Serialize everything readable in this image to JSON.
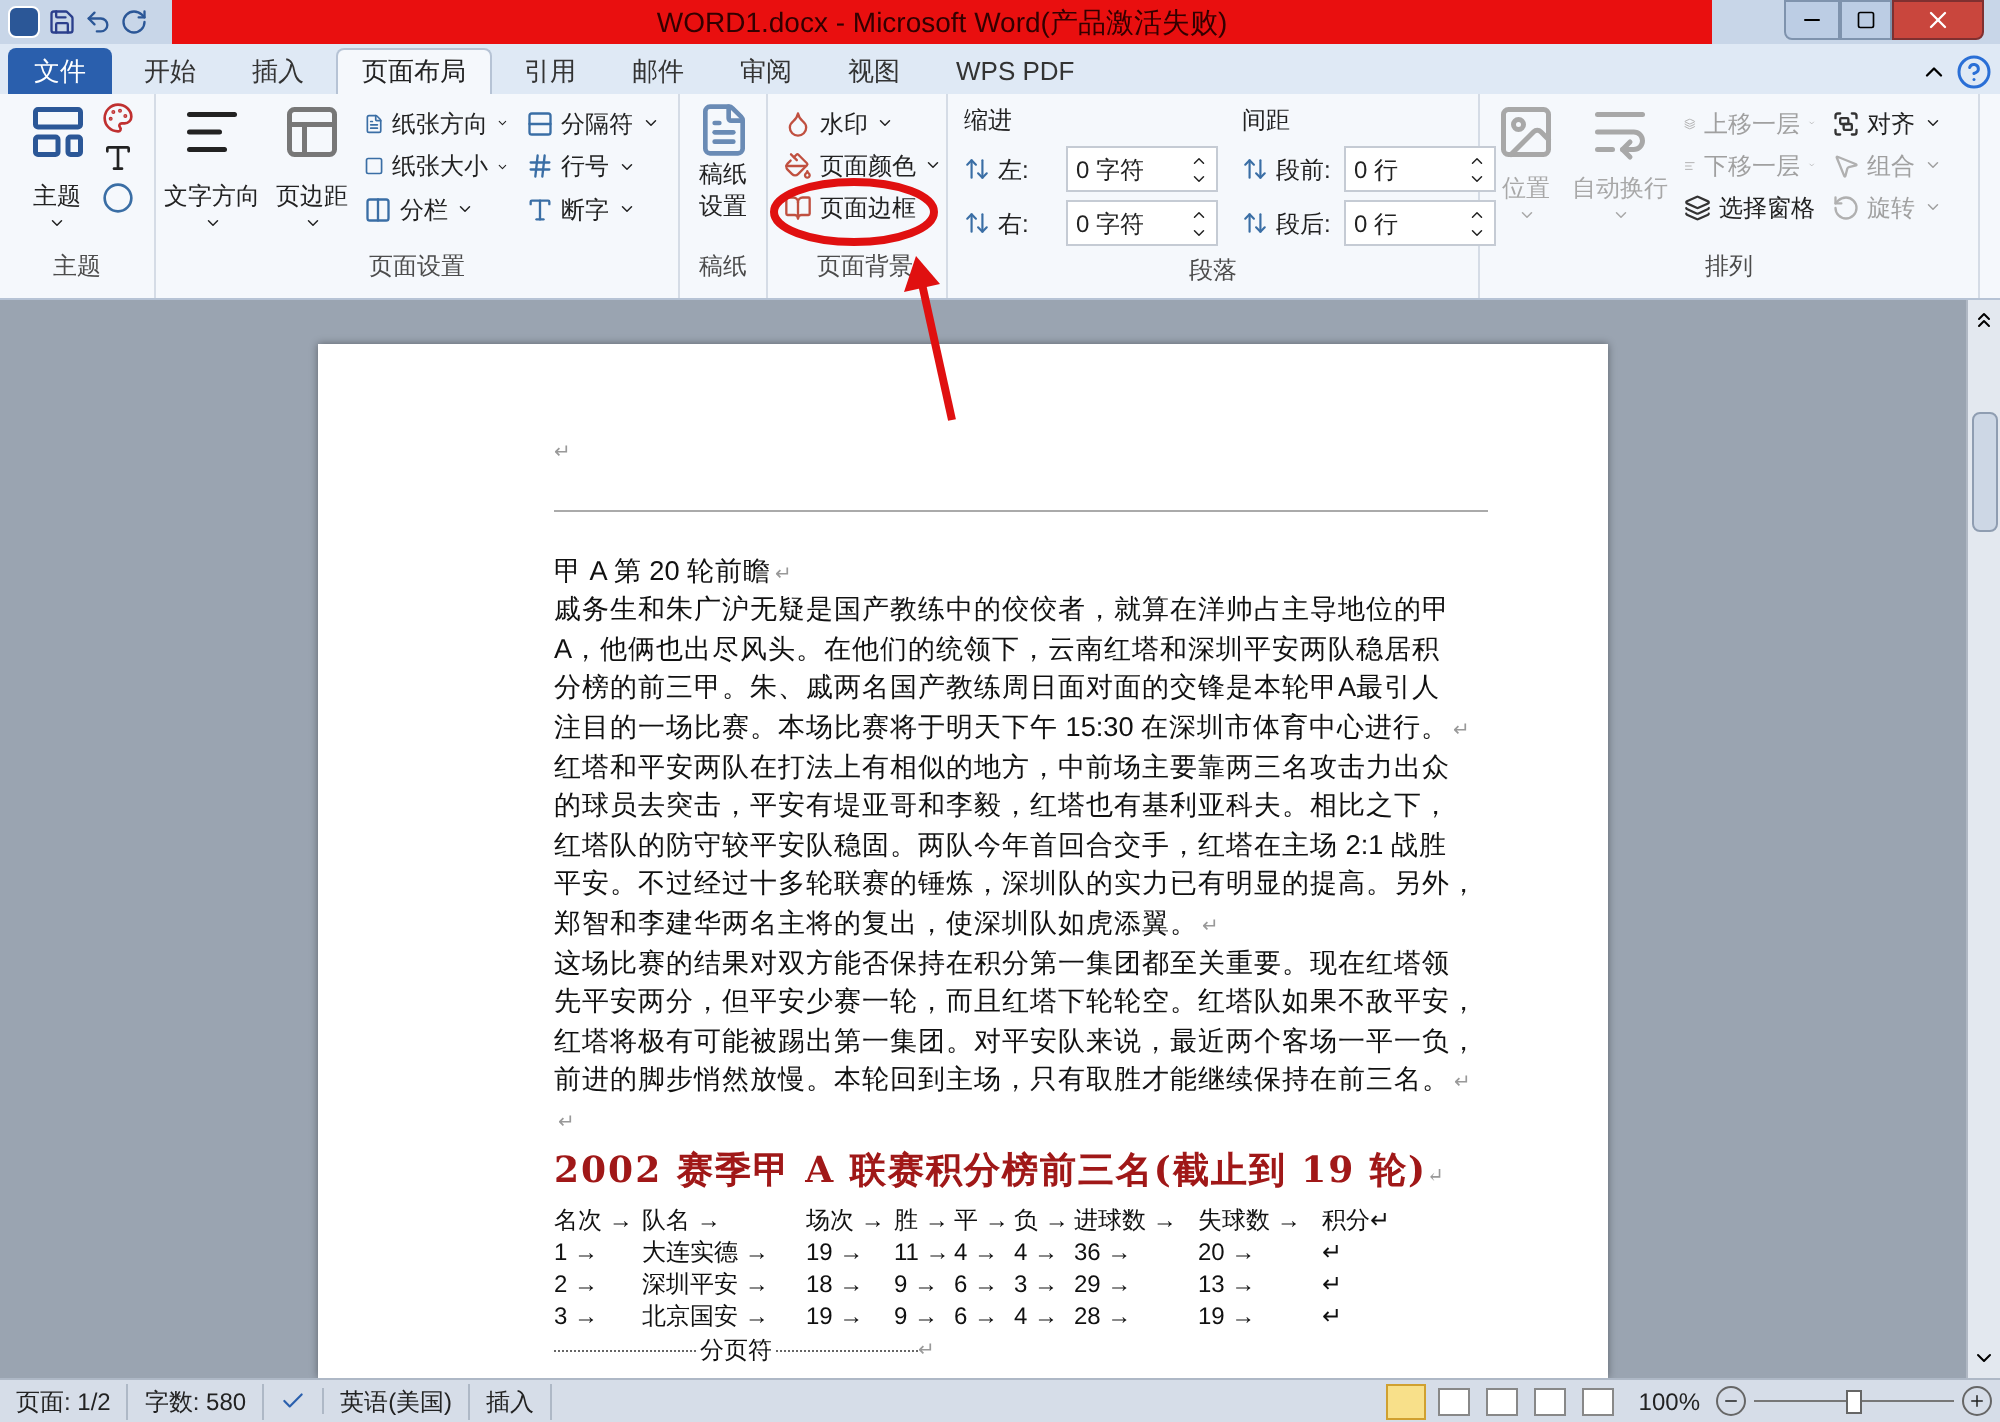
{
  "window": {
    "title": "WORD1.docx - Microsoft Word(产品激活失败)"
  },
  "tabs": [
    {
      "label": "文件",
      "kind": "file",
      "selected": false
    },
    {
      "label": "开始",
      "kind": "tab",
      "selected": false
    },
    {
      "label": "插入",
      "kind": "tab",
      "selected": false
    },
    {
      "label": "页面布局",
      "kind": "tab",
      "selected": true
    },
    {
      "label": "引用",
      "kind": "tab",
      "selected": false
    },
    {
      "label": "邮件",
      "kind": "tab",
      "selected": false
    },
    {
      "label": "审阅",
      "kind": "tab",
      "selected": false
    },
    {
      "label": "视图",
      "kind": "tab",
      "selected": false
    },
    {
      "label": "WPS PDF",
      "kind": "tab",
      "selected": false
    }
  ],
  "theme_group": {
    "label": "主题",
    "button": "主题"
  },
  "page_setup": {
    "label": "页面设置",
    "large": [
      "文字方向",
      "页边距"
    ],
    "small": [
      "纸张方向",
      "纸张大小",
      "分栏",
      "分隔符",
      "行号",
      "断字"
    ]
  },
  "manuscript": {
    "label": "稿纸",
    "button": [
      "稿纸",
      "设置"
    ]
  },
  "page_background": {
    "label": "页面背景",
    "items": [
      "水印",
      "页面颜色",
      "页面边框"
    ]
  },
  "paragraph": {
    "label": "段落",
    "indent_title": "缩进",
    "spacing_title": "间距",
    "fields": [
      {
        "label": "左:",
        "value": "0 字符"
      },
      {
        "label": "右:",
        "value": "0 字符"
      },
      {
        "label": "段前:",
        "value": "0 行"
      },
      {
        "label": "段后:",
        "value": "0 行"
      }
    ]
  },
  "arrange": {
    "label": "排列",
    "large": [
      {
        "label": "位置",
        "disabled": true
      },
      {
        "label": "自动换行",
        "disabled": true
      }
    ],
    "small": [
      {
        "label": "上移一层",
        "disabled": true
      },
      {
        "label": "下移一层",
        "disabled": true
      },
      {
        "label": "选择窗格",
        "disabled": false
      },
      {
        "label": "对齐",
        "disabled": false
      },
      {
        "label": "组合",
        "disabled": true
      },
      {
        "label": "旋转",
        "disabled": true
      }
    ]
  },
  "document": {
    "header_mark": "↵",
    "lines": [
      {
        "text": "甲 A 第 20 轮前瞻",
        "mark": "↵"
      },
      {
        "text": "戚务生和朱广沪无疑是国产教练中的佼佼者，就算在洋帅占主导地位的甲"
      },
      {
        "text": "A，他俩也出尽风头。在他们的统领下，云南红塔和深圳平安两队稳居积"
      },
      {
        "text": "分榜的前三甲。朱、戚两名国产教练周日面对面的交锋是本轮甲A最引人"
      },
      {
        "text": "注目的一场比赛。本场比赛将于明天下午 15:30 在深圳市体育中心进行。",
        "mark": "↵"
      },
      {
        "text": "红塔和平安两队在打法上有相似的地方，中前场主要靠两三名攻击力出众"
      },
      {
        "text": "的球员去突击，平安有堤亚哥和李毅，红塔也有基利亚科夫。相比之下，"
      },
      {
        "text": "红塔队的防守较平安队稳固。两队今年首回合交手，红塔在主场 2:1 战胜"
      },
      {
        "text": "平安。不过经过十多轮联赛的锤炼，深圳队的实力已有明显的提高。另外，"
      },
      {
        "text": "郑智和李建华两名主将的复出，使深圳队如虎添翼。",
        "mark": "↵"
      },
      {
        "text": "这场比赛的结果对双方能否保持在积分第一集团都至关重要。现在红塔领"
      },
      {
        "text": "先平安两分，但平安少赛一轮，而且红塔下轮轮空。红塔队如果不敌平安，"
      },
      {
        "text": "红塔将极有可能被踢出第一集团。对平安队来说，最近两个客场一平一负，"
      },
      {
        "text": "前进的脚步悄然放慢。本轮回到主场，只有取胜才能继续保持在前三名。",
        "mark": "↵"
      },
      {
        "mark": "↵"
      }
    ],
    "heading": {
      "text": "2002 赛季甲 A 联赛积分榜前三名(截止到 19 轮)",
      "mark": "↵"
    },
    "table": [
      [
        "名次 →",
        "队名 →",
        "场次 →",
        "胜 →",
        "平 →",
        "负 →",
        "进球数 →",
        "失球数 →",
        "积分↵"
      ],
      [
        "1 →",
        "大连实德 →",
        "19 →",
        "11 →",
        "4 →",
        "4 →",
        "36 →",
        "20 →",
        "↵"
      ],
      [
        "2 →",
        "深圳平安 →",
        "18 →",
        "9 →",
        "6 →",
        "3 →",
        "29 →",
        "13 →",
        "↵"
      ],
      [
        "3 →",
        "北京国安 →",
        "19 →",
        "9 →",
        "6 →",
        "4 →",
        "28 →",
        "19 →",
        "↵"
      ]
    ],
    "page_break": "分页符",
    "page_break_mark": "↵"
  },
  "status_bar": {
    "items": [
      "页面: 1/2",
      "字数: 580",
      "英语(美国)",
      "插入"
    ],
    "zoom": "100%",
    "zoom_slider": {
      "level": 0.5
    }
  }
}
